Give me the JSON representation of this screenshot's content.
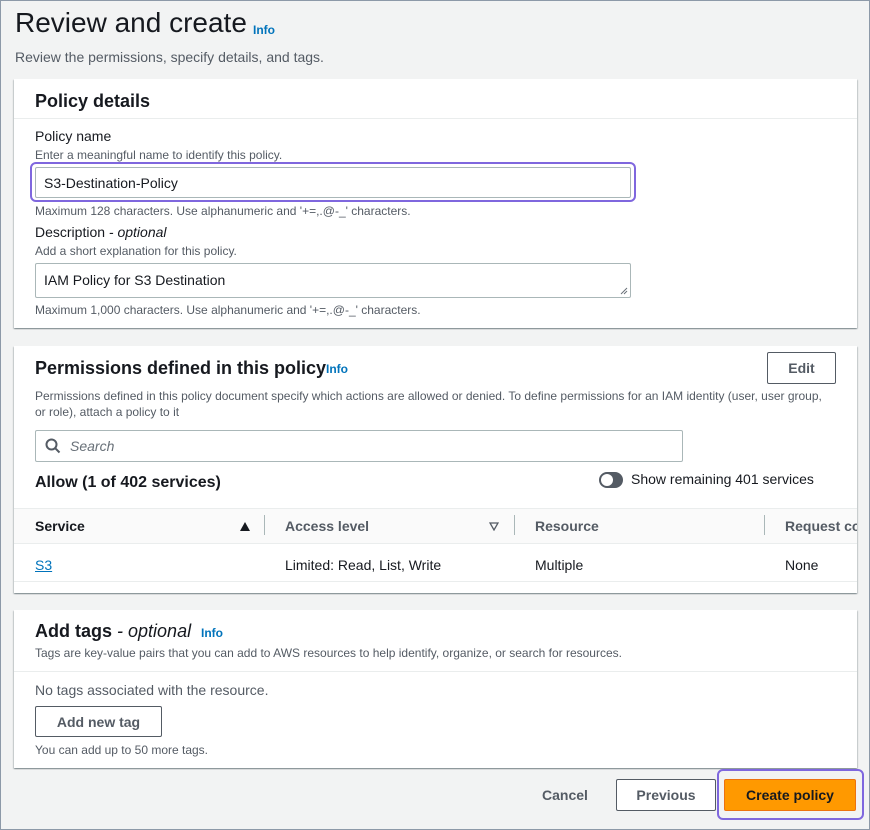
{
  "header": {
    "title": "Review and create",
    "info": "Info",
    "subtitle": "Review the permissions, specify details, and tags."
  },
  "policy_details": {
    "title": "Policy details",
    "name_label": "Policy name",
    "name_description": "Enter a meaningful name to identify this policy.",
    "name_value": "S3-Destination-Policy",
    "name_constraint": "Maximum 128 characters. Use alphanumeric and '+=,.@-_' characters.",
    "description_label": "Description",
    "description_optional": "- optional",
    "description_help": "Add a short explanation for this policy.",
    "description_value": "IAM Policy for S3 Destination",
    "description_constraint": "Maximum 1,000 characters. Use alphanumeric and '+=,.@-_' characters."
  },
  "permissions": {
    "title": "Permissions defined in this policy",
    "info": "Info",
    "edit_label": "Edit",
    "description": "Permissions defined in this policy document specify which actions are allowed or denied. To define permissions for an IAM identity (user, user group, or role), attach a policy to it",
    "search_placeholder": "Search",
    "allow_heading": "Allow (1 of 402 services)",
    "toggle_label": "Show remaining 401 services",
    "columns": [
      "Service",
      "Access level",
      "Resource",
      "Request co"
    ],
    "rows": [
      {
        "service": "S3",
        "access_level": "Limited: Read, List, Write",
        "resource": "Multiple",
        "request_conditions": "None"
      }
    ]
  },
  "tags": {
    "title": "Add tags",
    "optional": "- optional",
    "info": "Info",
    "description": "Tags are key-value pairs that you can add to AWS resources to help identify, organize, or search for resources.",
    "empty_text": "No tags associated with the resource.",
    "add_button": "Add new tag",
    "limit_text": "You can add up to 50 more tags."
  },
  "footer": {
    "cancel": "Cancel",
    "previous": "Previous",
    "create": "Create policy"
  },
  "colors": {
    "accent": "#ff9900",
    "link": "#0073bb",
    "focus": "#7f67de"
  },
  "icons": {
    "search": "search-icon",
    "sort_asc": "sort-ascending-icon",
    "sort": "sort-descending-icon",
    "resize": "resize-grip-icon"
  }
}
